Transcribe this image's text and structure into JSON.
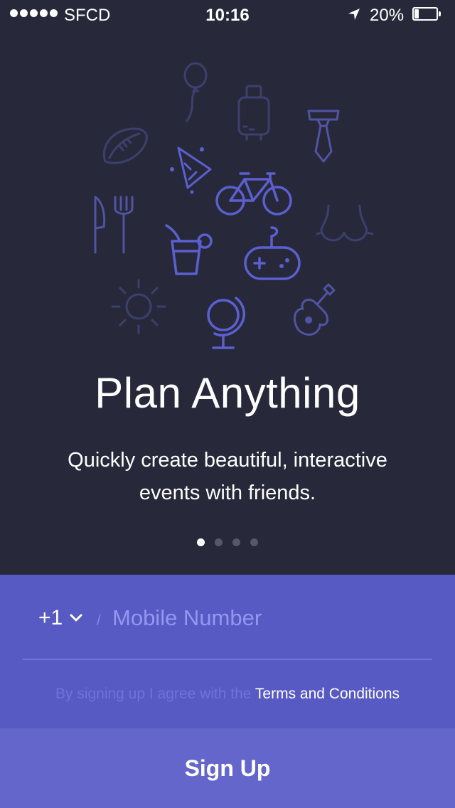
{
  "status_bar": {
    "carrier": "SFCD",
    "time": "10:16",
    "battery_percent": "20%",
    "battery_level": 0.2,
    "icons": [
      "signal-dots-icon",
      "location-arrow-icon",
      "battery-icon"
    ]
  },
  "illustration": {
    "icons": [
      "balloon-icon",
      "luggage-icon",
      "necktie-icon",
      "football-icon",
      "party-hat-icon",
      "bicycle-icon",
      "fork-knife-icon",
      "drink-icon",
      "game-controller-icon",
      "bikini-top-icon",
      "sun-icon",
      "globe-icon",
      "guitar-icon"
    ],
    "colors": {
      "bright": "#5b5fd0",
      "dim": "#3d3f6e"
    }
  },
  "hero": {
    "title": "Plan Anything",
    "subtitle_line1": "Quickly create beautiful, interactive",
    "subtitle_line2": "events with friends."
  },
  "pager": {
    "count": 4,
    "active": 0
  },
  "signup": {
    "country_code": "+1",
    "phone_placeholder": "Mobile Number",
    "phone_value": "",
    "terms_prefix": "By signing up I agree with the ",
    "terms_link": "Terms and Conditions",
    "button_label": "Sign Up"
  },
  "colors": {
    "background": "#27293a",
    "panel": "#585ac4",
    "button": "#6466cc",
    "accent": "#5b5fd0"
  }
}
